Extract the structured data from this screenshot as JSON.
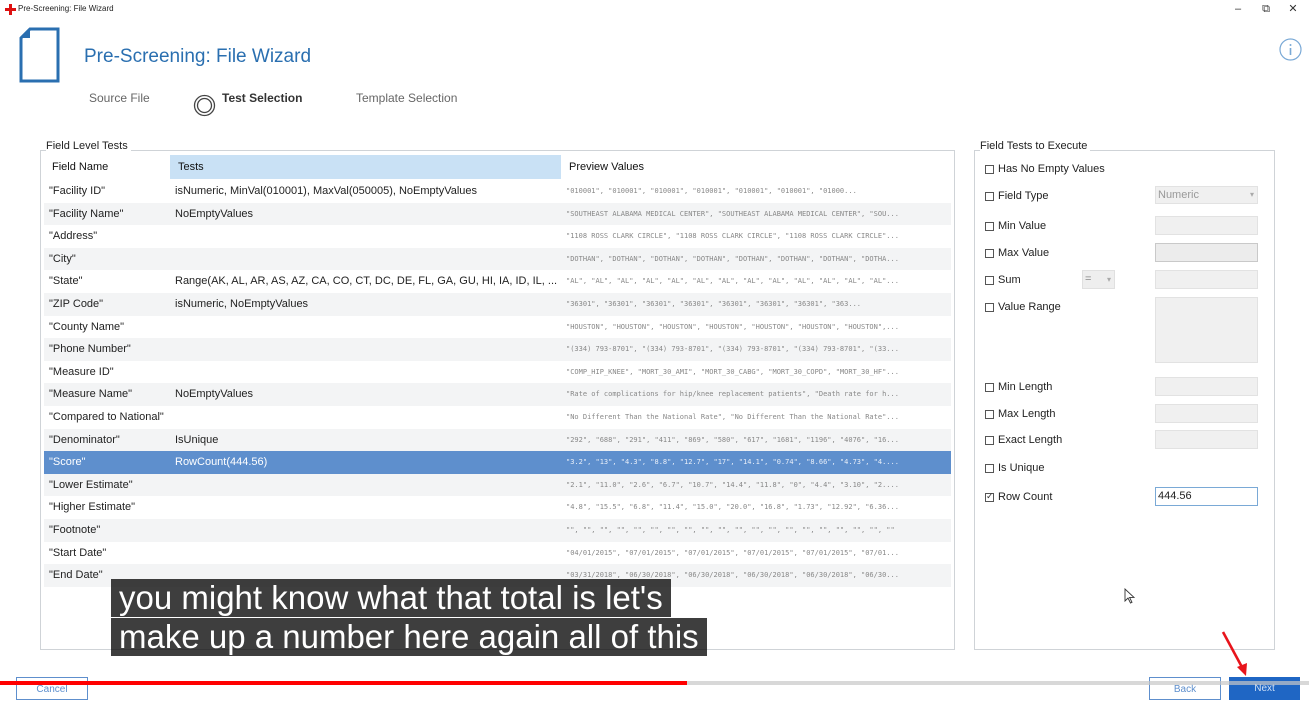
{
  "window": {
    "title": "Pre-Screening: File Wizard",
    "minimize": "–",
    "restore": "⧉",
    "close": "✕"
  },
  "header": {
    "title": "Pre-Screening: File Wizard"
  },
  "steps": [
    "Source File",
    "Test Selection",
    "Template Selection"
  ],
  "active_step": "Test Selection",
  "field_tests": {
    "group_label": "Field Level Tests",
    "columns": [
      "Field Name",
      "Tests",
      "Preview Values"
    ],
    "rows": [
      {
        "name": "\"Facility ID\"",
        "tests": "isNumeric, MinVal(010001), MaxVal(050005), NoEmptyValues",
        "preview": "\"010001\", \"010001\", \"010001\", \"010001\", \"010001\", \"010001\", \"01000..."
      },
      {
        "name": "\"Facility Name\"",
        "tests": "NoEmptyValues",
        "preview": "\"SOUTHEAST ALABAMA MEDICAL CENTER\", \"SOUTHEAST ALABAMA MEDICAL CENTER\", \"SOU..."
      },
      {
        "name": "\"Address\"",
        "tests": "",
        "preview": "\"1108 ROSS CLARK CIRCLE\", \"1108 ROSS CLARK CIRCLE\", \"1108 ROSS CLARK CIRCLE\"..."
      },
      {
        "name": "\"City\"",
        "tests": "",
        "preview": "\"DOTHAN\", \"DOTHAN\", \"DOTHAN\", \"DOTHAN\", \"DOTHAN\", \"DOTHAN\", \"DOTHAN\", \"DOTHA..."
      },
      {
        "name": "\"State\"",
        "tests": "Range(AK, AL, AR, AS, AZ, CA, CO, CT, DC, DE, FL, GA, GU, HI, IA, ID, IL, ...",
        "preview": "\"AL\", \"AL\", \"AL\", \"AL\", \"AL\", \"AL\", \"AL\", \"AL\", \"AL\", \"AL\", \"AL\", \"AL\", \"AL\"..."
      },
      {
        "name": "\"ZIP Code\"",
        "tests": "isNumeric, NoEmptyValues",
        "preview": "\"36301\", \"36301\", \"36301\", \"36301\", \"36301\", \"36301\", \"36301\", \"363..."
      },
      {
        "name": "\"County Name\"",
        "tests": "",
        "preview": "\"HOUSTON\", \"HOUSTON\", \"HOUSTON\", \"HOUSTON\", \"HOUSTON\", \"HOUSTON\", \"HOUSTON\",..."
      },
      {
        "name": "\"Phone Number\"",
        "tests": "",
        "preview": "\"(334) 793-8701\", \"(334) 793-8701\", \"(334) 793-8701\", \"(334) 793-8701\", \"(33..."
      },
      {
        "name": "\"Measure ID\"",
        "tests": "",
        "preview": "\"COMP_HIP_KNEE\", \"MORT_30_AMI\", \"MORT_30_CABG\", \"MORT_30_COPD\", \"MORT_30_HF\"..."
      },
      {
        "name": "\"Measure Name\"",
        "tests": "NoEmptyValues",
        "preview": "\"Rate of complications for hip/knee replacement patients\", \"Death rate for h..."
      },
      {
        "name": "\"Compared to National\"",
        "tests": "",
        "preview": "\"No Different Than the National Rate\", \"No Different Than the National Rate\"..."
      },
      {
        "name": "\"Denominator\"",
        "tests": "IsUnique",
        "preview": "\"292\", \"688\", \"291\", \"411\", \"869\", \"580\", \"617\", \"1681\", \"1196\", \"4076\", \"16..."
      },
      {
        "name": "\"Score\"",
        "tests": "RowCount(444.56)",
        "preview": "\"3.2\", \"13\", \"4.3\", \"8.8\", \"12.7\", \"17\", \"14.1\", \"0.74\", \"8.66\", \"4.73\", \"4...."
      },
      {
        "name": "\"Lower Estimate\"",
        "tests": "",
        "preview": "\"2.1\", \"11.0\", \"2.6\", \"6.7\", \"10.7\", \"14.4\", \"11.8\", \"0\", \"4.4\", \"3.10\", \"2...."
      },
      {
        "name": "\"Higher Estimate\"",
        "tests": "",
        "preview": "\"4.8\", \"15.5\", \"6.8\", \"11.4\", \"15.0\", \"20.0\", \"16.8\", \"1.73\", \"12.92\", \"6.36..."
      },
      {
        "name": "\"Footnote\"",
        "tests": "",
        "preview": "\"\", \"\", \"\", \"\", \"\", \"\", \"\", \"\", \"\", \"\", \"\", \"\", \"\", \"\", \"\", \"\", \"\", \"\", \"\", \"\""
      },
      {
        "name": "\"Start Date\"",
        "tests": "",
        "preview": "\"04/01/2015\", \"07/01/2015\", \"07/01/2015\", \"07/01/2015\", \"07/01/2015\", \"07/01..."
      },
      {
        "name": "\"End Date\"",
        "tests": "",
        "preview": "\"03/31/2018\", \"06/30/2018\", \"06/30/2018\", \"06/30/2018\", \"06/30/2018\", \"06/30..."
      }
    ],
    "selected_row": "\"Score\""
  },
  "execute": {
    "group_label": "Field Tests to Execute",
    "has_no_empty": "Has No Empty Values",
    "field_type": "Field Type",
    "field_type_value": "Numeric",
    "min_value": "Min Value",
    "max_value": "Max Value",
    "sum": "Sum",
    "sum_operator": "=",
    "value_range": "Value Range",
    "min_length": "Min Length",
    "max_length": "Max Length",
    "exact_length": "Exact Length",
    "is_unique": "Is Unique",
    "row_count": "Row Count",
    "row_count_checked": true,
    "row_count_value": "444.56"
  },
  "buttons": {
    "cancel": "Cancel",
    "back": "Back",
    "next": "Next"
  },
  "video": {
    "caption_line1": "you might know what that total is let's",
    "caption_line2": "make up a number here again all of this",
    "progress_fraction": 0.525
  },
  "colors": {
    "accent": "#2a6fb0",
    "selection": "#5e8fcd",
    "tests_header": "#c9e1f5",
    "progress": "#ff0000"
  }
}
